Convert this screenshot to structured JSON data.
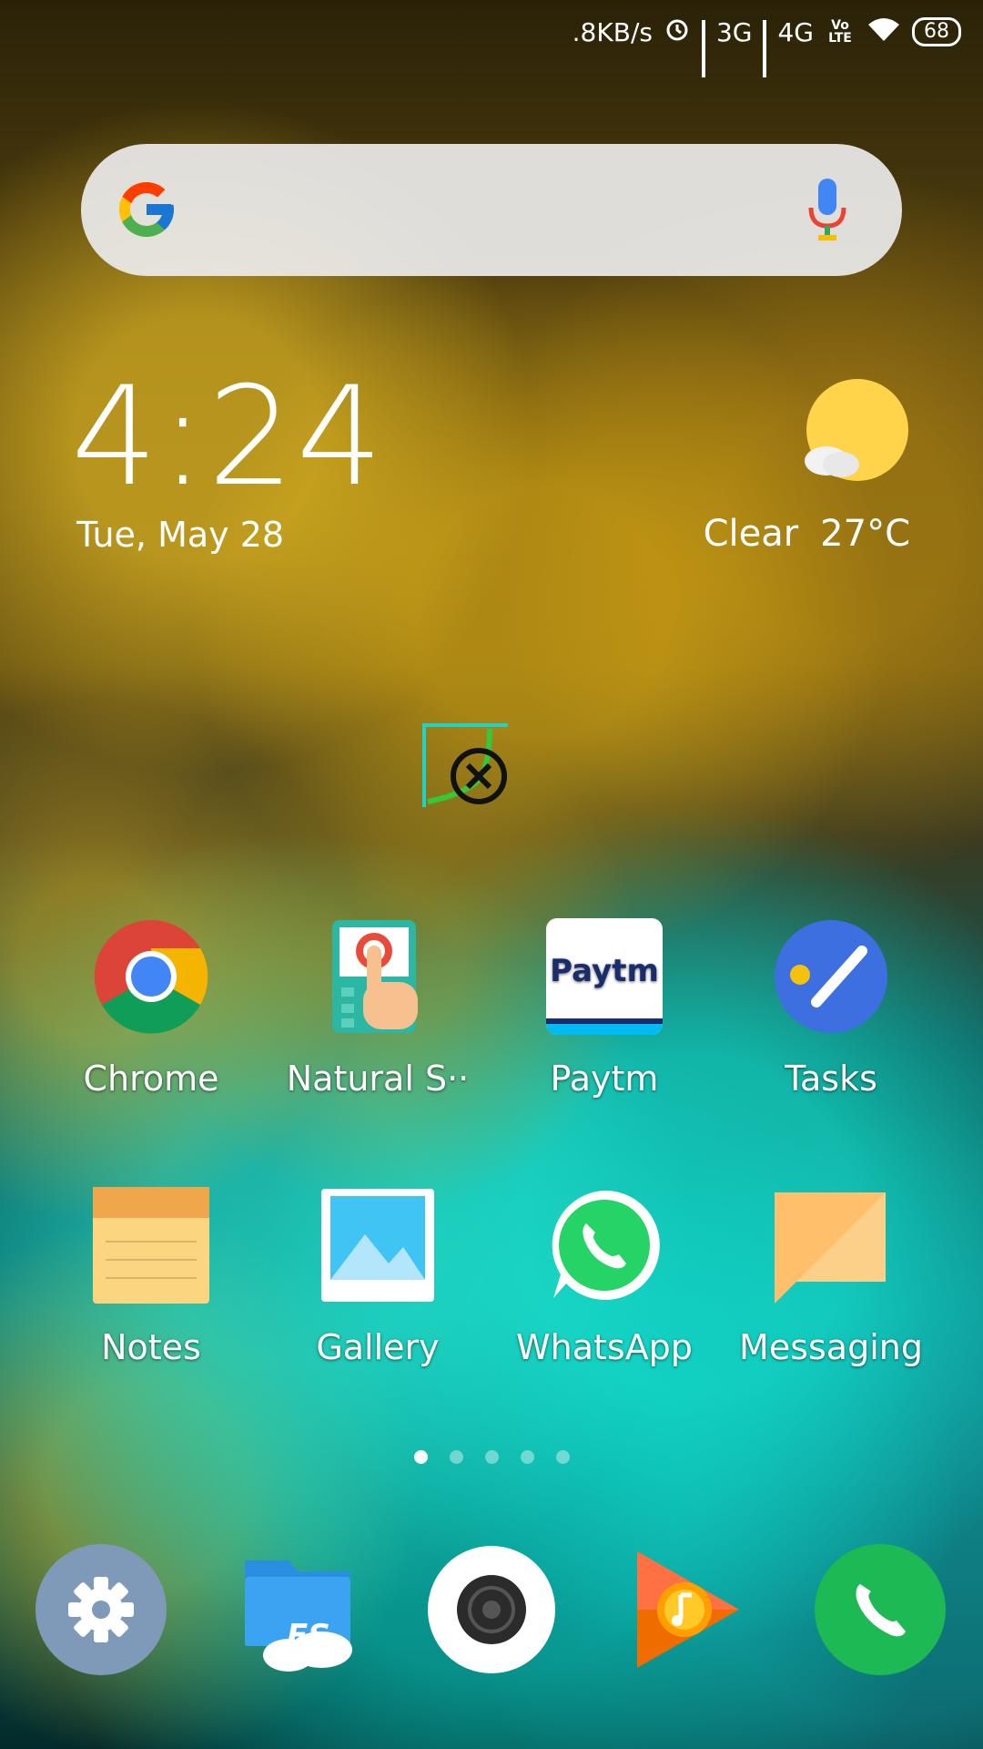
{
  "status_bar": {
    "speed": ".8KB/s",
    "net1": "3G",
    "net2": "4G",
    "volte": "Vo LTE",
    "battery": "68"
  },
  "search": {
    "icons": [
      "google-g-icon",
      "microphone-icon"
    ]
  },
  "clock_widget": {
    "time": "4:24",
    "date": "Tue, May 28"
  },
  "weather_widget": {
    "condition": "Clear",
    "temperature": "27°C"
  },
  "apps_row1": [
    {
      "label": "Chrome"
    },
    {
      "label": "Natural S··"
    },
    {
      "label": "Paytm",
      "icon_text": "Paytm"
    },
    {
      "label": "Tasks"
    }
  ],
  "apps_row2": [
    {
      "label": "Notes"
    },
    {
      "label": "Gallery"
    },
    {
      "label": "WhatsApp"
    },
    {
      "label": "Messaging"
    }
  ],
  "page_indicator": {
    "pages": 5,
    "current": 1
  },
  "dock": [
    "settings-icon",
    "es-file-explorer-icon",
    "camera-icon",
    "play-music-icon",
    "phone-icon"
  ],
  "colors": {
    "chrome_red": "#db4437",
    "chrome_yellow": "#f4b400",
    "chrome_green": "#0f9d58",
    "chrome_blue": "#4285f4",
    "whatsapp_green": "#25d366",
    "phone_green": "#1db954",
    "tasks_blue": "#3d6fe0",
    "notes_yellow": "#fbd580",
    "messaging_orange": "#ffbf6b",
    "weather_sun": "#ffd34a"
  }
}
